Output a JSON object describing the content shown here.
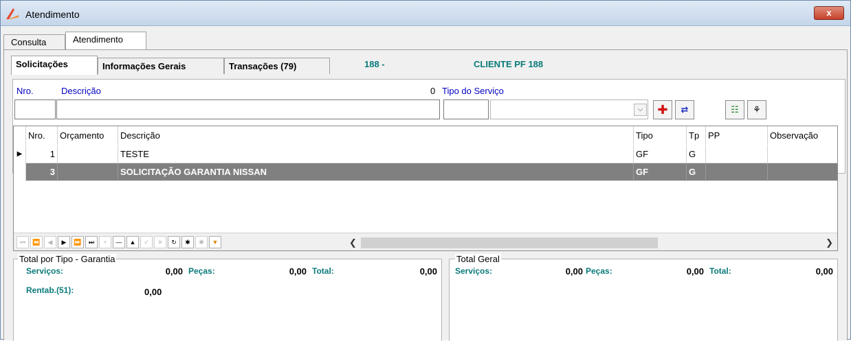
{
  "window": {
    "title": "Atendimento",
    "close_label": "x"
  },
  "outer_tabs": [
    {
      "label": "Consulta"
    },
    {
      "label": "Atendimento"
    }
  ],
  "inner_tabs": [
    {
      "label": "Solicitações"
    },
    {
      "label": "Informações Gerais"
    },
    {
      "label": "Transações (79)"
    }
  ],
  "header": {
    "code": "188 -",
    "client": "CLIENTE PF 188"
  },
  "form": {
    "nro_label": "Nro.",
    "descricao_label": "Descrição",
    "counter": "0",
    "tipo_servico_label": "Tipo do Serviço",
    "nro_value": "",
    "descricao_value": "",
    "tipo_code_value": "",
    "tipo_select_value": ""
  },
  "grid": {
    "columns": [
      "Nro.",
      "Orçamento",
      "Descrição",
      "Tipo",
      "Tp",
      "PP",
      "Observação"
    ],
    "rows": [
      {
        "nro": "1",
        "orcamento": "",
        "descricao": "TESTE",
        "tipo": "GF",
        "tp": "G",
        "pp": "",
        "obs": ""
      },
      {
        "nro": "3",
        "orcamento": "",
        "descricao": "SOLICITAÇÃO GARANTIA NISSAN",
        "tipo": "GF",
        "tp": "G",
        "pp": "",
        "obs": ""
      }
    ]
  },
  "totals_tipo": {
    "title": "Total por Tipo - Garantia",
    "servicos_label": "Serviços:",
    "servicos_value": "0,00",
    "pecas_label": "Peças:",
    "pecas_value": "0,00",
    "total_label": "Total:",
    "total_value": "0,00",
    "rentab_label": "Rentab.(51):",
    "rentab_value": "0,00"
  },
  "totals_geral": {
    "title": "Total Geral",
    "servicos_label": "Serviços:",
    "servicos_value": "0,00",
    "pecas_label": "Peças:",
    "pecas_value": "0,00",
    "total_label": "Total:",
    "total_value": "0,00"
  },
  "colors": {
    "accent_teal": "#0a7a7a",
    "label_blue": "#0000c0",
    "selected_row": "#808080"
  }
}
